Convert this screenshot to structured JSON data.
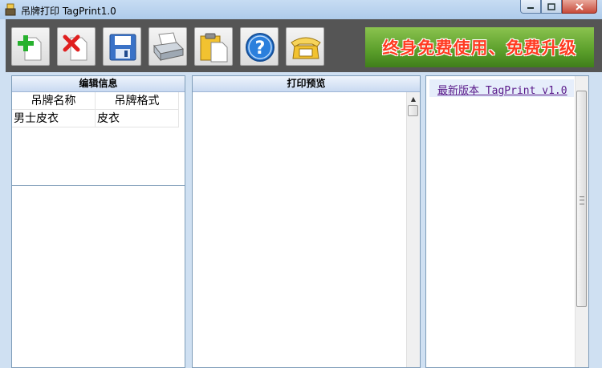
{
  "window": {
    "title": "吊牌打印 TagPrint1.0"
  },
  "toolbar": {
    "buttons": [
      {
        "name": "add",
        "icon": "plus-icon"
      },
      {
        "name": "delete",
        "icon": "x-icon"
      },
      {
        "name": "save",
        "icon": "floppy-disk-icon"
      },
      {
        "name": "print",
        "icon": "printer-icon"
      },
      {
        "name": "paste",
        "icon": "clipboard-icon"
      },
      {
        "name": "help",
        "icon": "help-icon"
      },
      {
        "name": "contact",
        "icon": "telephone-icon"
      }
    ],
    "banner": "终身免费使用、免费升级"
  },
  "edit_panel": {
    "title": "编辑信息",
    "columns": [
      "吊牌名称",
      "吊牌格式"
    ],
    "rows": [
      [
        "男士皮衣",
        "皮衣"
      ]
    ]
  },
  "preview_panel": {
    "title": "打印预览"
  },
  "info_panel": {
    "link": "最新版本 TagPrint v1.0"
  },
  "colors": {
    "accent": "#5a1a8a",
    "banner_text": "#ff3b22",
    "toolbar_bg": "#555555"
  }
}
